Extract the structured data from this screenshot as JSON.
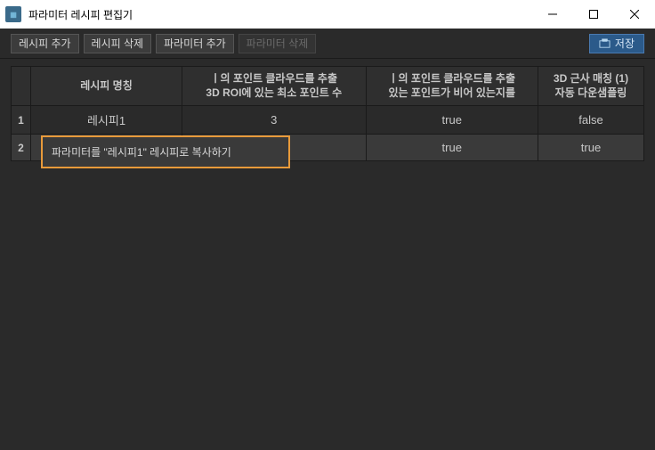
{
  "window": {
    "title": "파라미터 레시피 편집기"
  },
  "toolbar": {
    "recipe_add": "레시피 추가",
    "recipe_delete": "레시피 삭제",
    "param_add": "파라미터 추가",
    "param_delete": "파라미터 삭제",
    "save": "저장"
  },
  "table": {
    "headers": {
      "name": "레시피 명칭",
      "col2": "ㅣ의 포인트 클라우드를 추출\n3D ROI에 있는 최소 포인트 수",
      "col3": "ㅣ의 포인트 클라우드를 추출\n있는 포인트가 비어 있는지를",
      "col4": "3D 근사 매칭 (1)\n자동 다운샘플링"
    },
    "rows": [
      {
        "num": "1",
        "name": "레시피1",
        "col2": "3",
        "col3": "true",
        "col4": "false"
      },
      {
        "num": "2",
        "name": "",
        "col2": "",
        "col3": "true",
        "col4": "true"
      }
    ]
  },
  "context_menu": {
    "copy_to": "파라미터를 \"레시피1\" 레시피로 복사하기"
  }
}
